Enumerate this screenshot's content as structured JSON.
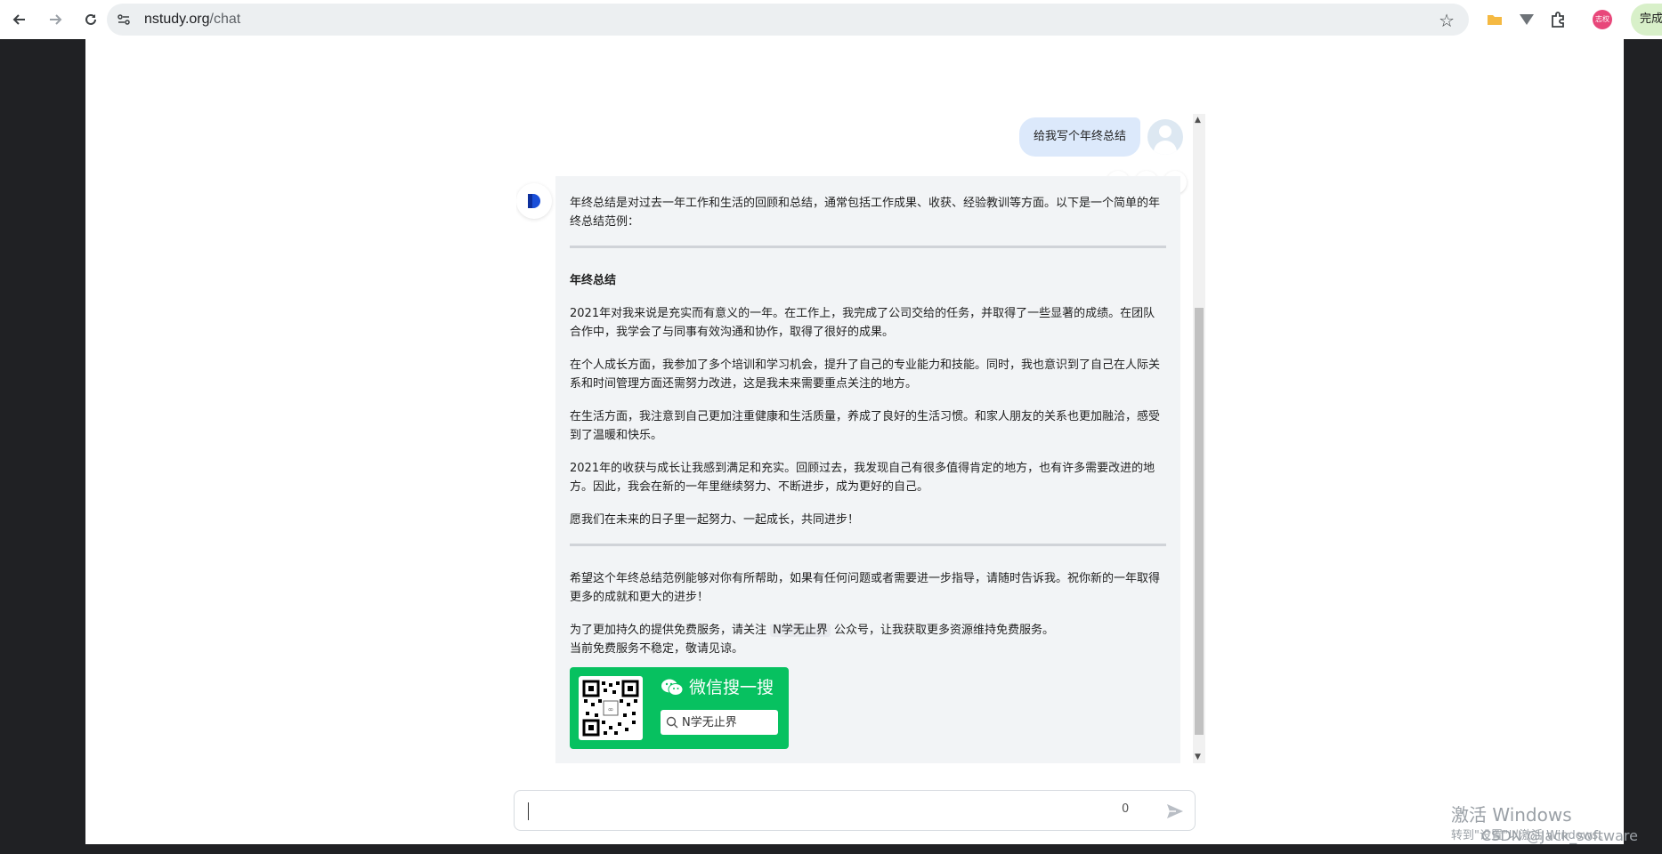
{
  "browser": {
    "url_host": "nstudy.org",
    "url_path": "/chat",
    "extension_badge": "志权",
    "complete_button": "完成更"
  },
  "chat": {
    "user_message": "给我写个年终总结",
    "bot_paragraphs": {
      "intro": "年终总结是对过去一年工作和生活的回顾和总结，通常包括工作成果、收获、经验教训等方面。以下是一个简单的年终总结范例：",
      "heading": "年终总结",
      "p1": "2021年对我来说是充实而有意义的一年。在工作上，我完成了公司交给的任务，并取得了一些显著的成绩。在团队合作中，我学会了与同事有效沟通和协作，取得了很好的成果。",
      "p2": "在个人成长方面，我参加了多个培训和学习机会，提升了自己的专业能力和技能。同时，我也意识到了自己在人际关系和时间管理方面还需努力改进，这是我未来需要重点关注的地方。",
      "p3": "在生活方面，我注意到自己更加注重健康和生活质量，养成了良好的生活习惯。和家人朋友的关系也更加融洽，感受到了温暖和快乐。",
      "p4": "2021年的收获与成长让我感到满足和充实。回顾过去，我发现自己有很多值得肯定的地方，也有许多需要改进的地方。因此，我会在新的一年里继续努力、不断进步，成为更好的自己。",
      "p5": "愿我们在未来的日子里一起努力、一起成长，共同进步！",
      "closing": "希望这个年终总结范例能够对你有所帮助，如果有任何问题或者需要进一步指导，请随时告诉我。祝你新的一年取得更多的成就和更大的进步！",
      "notice_prefix": "为了更加持久的提供免费服务，请关注 ",
      "notice_tag": "N学无止界",
      "notice_suffix": " 公众号，让我获取更多资源维持免费服务。",
      "notice_line2": "当前免费服务不稳定，敬请见谅。"
    },
    "wechat_card": {
      "title": "微信搜一搜",
      "search_text": "N学无止界"
    }
  },
  "input": {
    "placeholder": "",
    "char_count": "0"
  },
  "overlay": {
    "activate_windows": "激活 Windows",
    "activate_sub": "转到\"设置\"以激活 Windows。",
    "csdn": "CSDN @Jack_software"
  }
}
